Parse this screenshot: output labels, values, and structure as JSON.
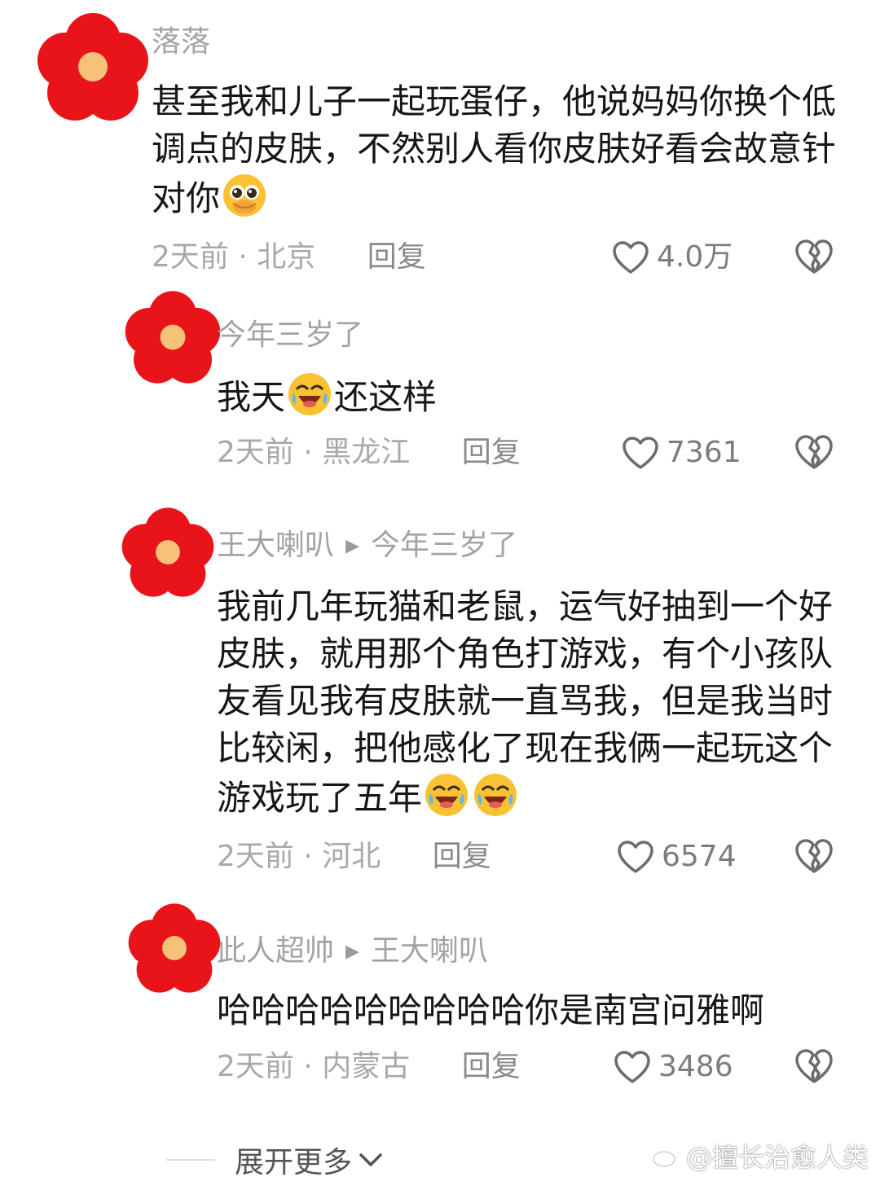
{
  "comments": [
    {
      "author": "落落",
      "text_before": "甚至我和儿子一起玩蛋仔，他说妈妈你换个低调点的皮肤，不然别人看你皮肤好看会故意针对你",
      "text_after": "",
      "emoji": "pleading-face-emoji",
      "time": "2天前",
      "location": "北京",
      "reply_label": "回复",
      "likes": "4.0万"
    },
    {
      "author": "今年三岁了",
      "text_before": "我天",
      "text_after": "还这样",
      "emoji": "laugh-cry-emoji",
      "time": "2天前",
      "location": "黑龙江",
      "reply_label": "回复",
      "likes": "7361"
    },
    {
      "author": "王大喇叭",
      "reply_to": "今年三岁了",
      "text_before": "我前几年玩猫和老鼠，运气好抽到一个好皮肤，就用那个角色打游戏，有个小孩队友看见我有皮肤就一直骂我，但是我当时比较闲，把他感化了现在我俩一起玩这个游戏玩了五年",
      "text_after": "",
      "emoji": "laugh-cry-emoji",
      "time": "2天前",
      "location": "河北",
      "reply_label": "回复",
      "likes": "6574"
    },
    {
      "author": "此人超帅",
      "reply_to": "王大喇叭",
      "text_before": "哈哈哈哈哈哈哈哈哈你是南宫问雅啊",
      "text_after": "",
      "time": "2天前",
      "location": "内蒙古",
      "reply_label": "回复",
      "likes": "3486"
    }
  ],
  "separator": "·",
  "expand_label": "展开更多",
  "watermark": "@擅长治愈人类",
  "colors": {
    "avatar_petal": "#e8141a",
    "avatar_center": "#f6c27a",
    "emoji_yellow": "#f9c232"
  }
}
